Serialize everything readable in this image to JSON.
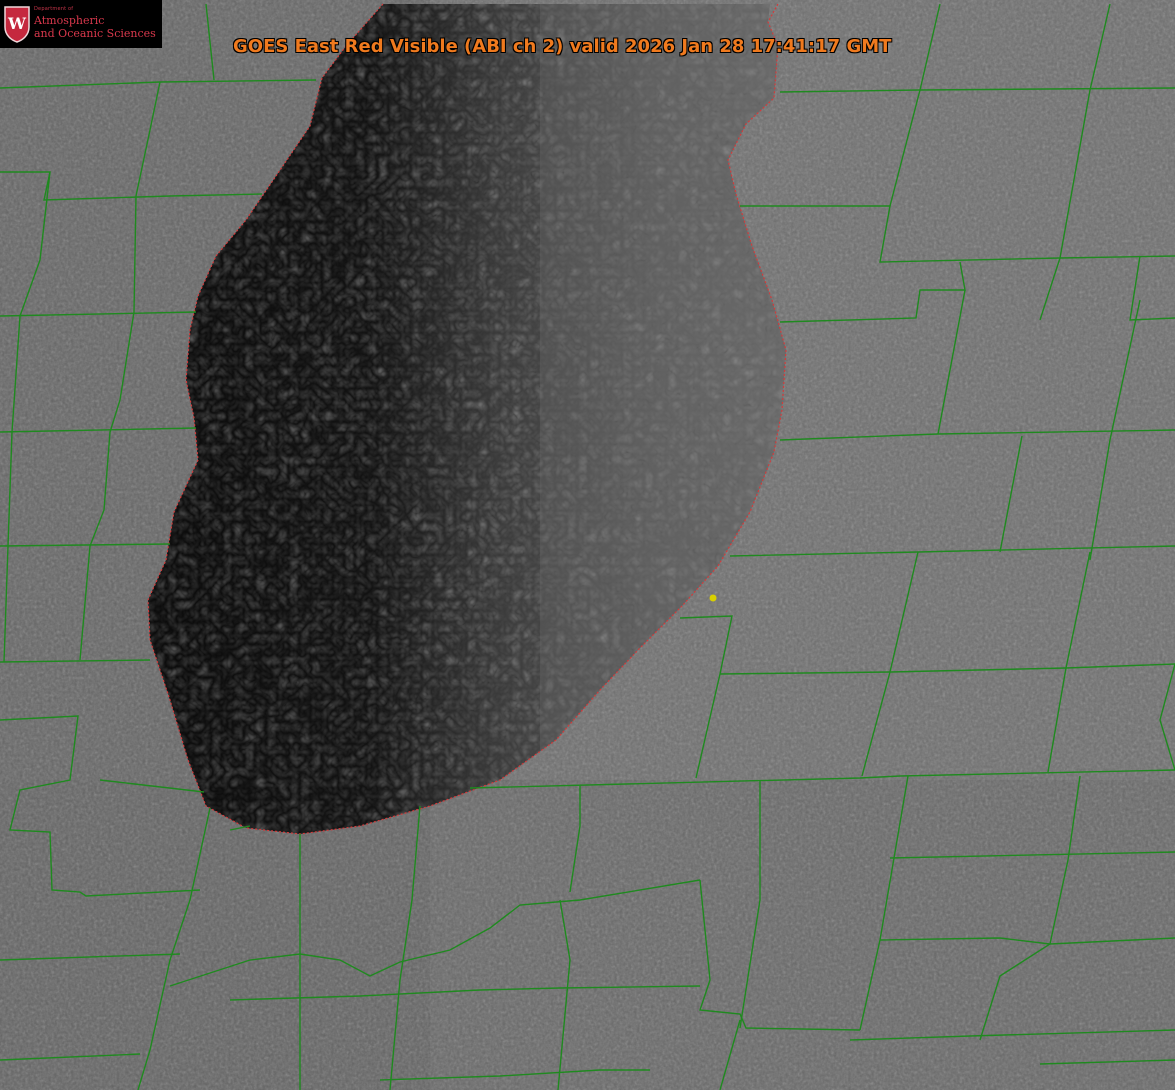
{
  "header": {
    "title": "GOES East Red Visible (ABI ch 2) valid 2026 Jan 28 17:41:17 GMT"
  },
  "logo": {
    "department": "Department of",
    "line1": "Atmospheric",
    "line2": "and Oceanic Sciences",
    "crest_letter": "W"
  },
  "colors": {
    "land": "#6d6d6d",
    "lake_dark": "#0c0c0c",
    "lake_cloud": "#5e5e5e",
    "county_lines": "#1f8a1f",
    "shoreline": "#d23b3b",
    "title": "#f07a1e",
    "marker": "#d8d000",
    "logo_red": "#c5283e"
  },
  "map": {
    "feature": "lake",
    "marker": "station-marker"
  }
}
